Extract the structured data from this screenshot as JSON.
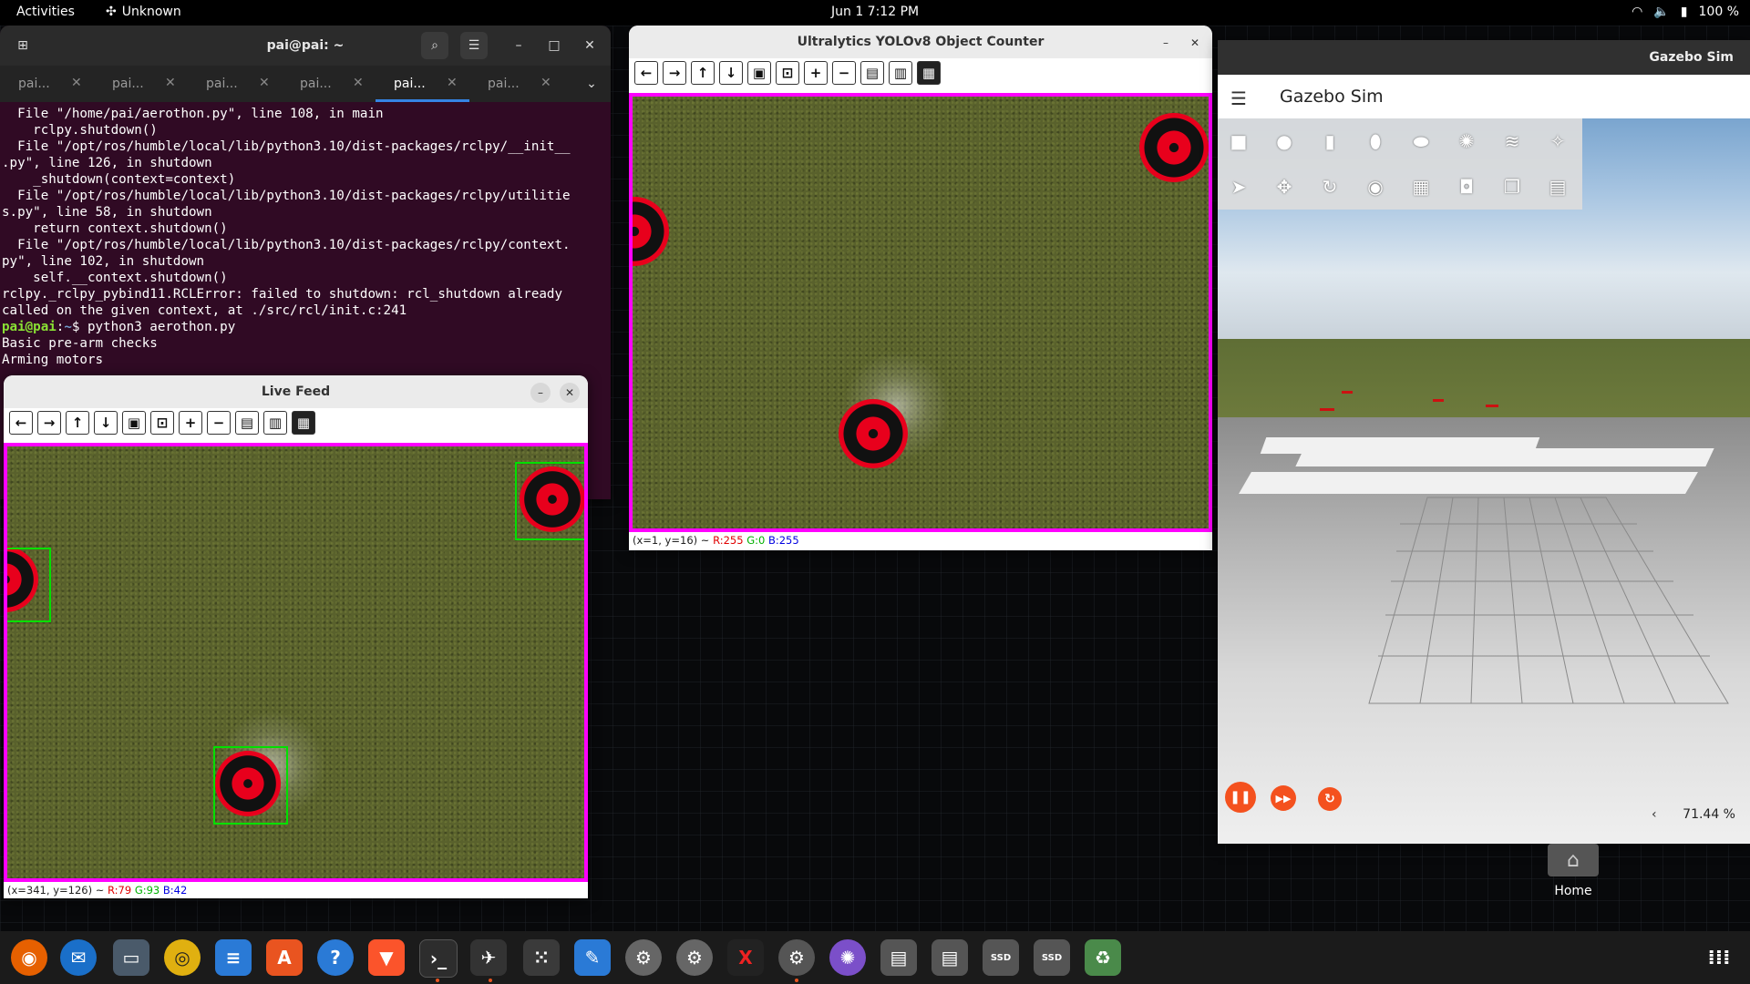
{
  "topbar": {
    "activities": "Activities",
    "app_indicator": "Unknown",
    "clock": "Jun 1  7:12 PM",
    "battery": "100 %"
  },
  "terminal": {
    "title": "pai@pai: ~",
    "tabs": [
      "pai...",
      "pai...",
      "pai...",
      "pai...",
      "pai...",
      "pai..."
    ],
    "active_tab": 4,
    "lines": [
      "  File \"/home/pai/aerothon.py\", line 108, in main",
      "    rclpy.shutdown()",
      "  File \"/opt/ros/humble/local/lib/python3.10/dist-packages/rclpy/__init__",
      ".py\", line 126, in shutdown",
      "    _shutdown(context=context)",
      "  File \"/opt/ros/humble/local/lib/python3.10/dist-packages/rclpy/utilitie",
      "s.py\", line 58, in shutdown",
      "    return context.shutdown()",
      "  File \"/opt/ros/humble/local/lib/python3.10/dist-packages/rclpy/context.",
      "py\", line 102, in shutdown",
      "    self.__context.shutdown()",
      "rclpy._rclpy_pybind11.RCLError: failed to shutdown: rcl_shutdown already",
      "called on the given context, at ./src/rcl/init.c:241"
    ],
    "prompt_user": "pai@pai",
    "prompt_path": "~",
    "command": "$ python3 aerothon.py",
    "output": [
      "Basic pre-arm checks",
      "Arming motors"
    ]
  },
  "live_feed": {
    "title": "Live Feed",
    "status_prefix": "(x=341, y=126) ~ ",
    "status_r": "R:79",
    "status_g": "G:93",
    "status_b": "B:42"
  },
  "counter": {
    "title": "Ultralytics YOLOv8 Object Counter",
    "status_prefix": "(x=1, y=16) ~ ",
    "status_r": "R:255",
    "status_g": "G:0",
    "status_b": "B:255"
  },
  "viewer_toolbar": [
    "pan-left",
    "pan-right",
    "pan-up",
    "pan-down",
    "zoom-image",
    "zoom-fit",
    "zoom-in",
    "zoom-out",
    "save",
    "copy",
    "properties"
  ],
  "gazebo": {
    "window_title": "Gazebo Sim",
    "app_name": "Gazebo Sim",
    "rtf": "71.44 %"
  },
  "desktop": {
    "home_label": "Home"
  },
  "colors": {
    "terminal_bg": "#300a24",
    "bbox_green": "#00e000",
    "frame_magenta": "#ff00ff",
    "gazebo_accent": "#f4511e",
    "ubuntu_orange": "#e95420"
  }
}
